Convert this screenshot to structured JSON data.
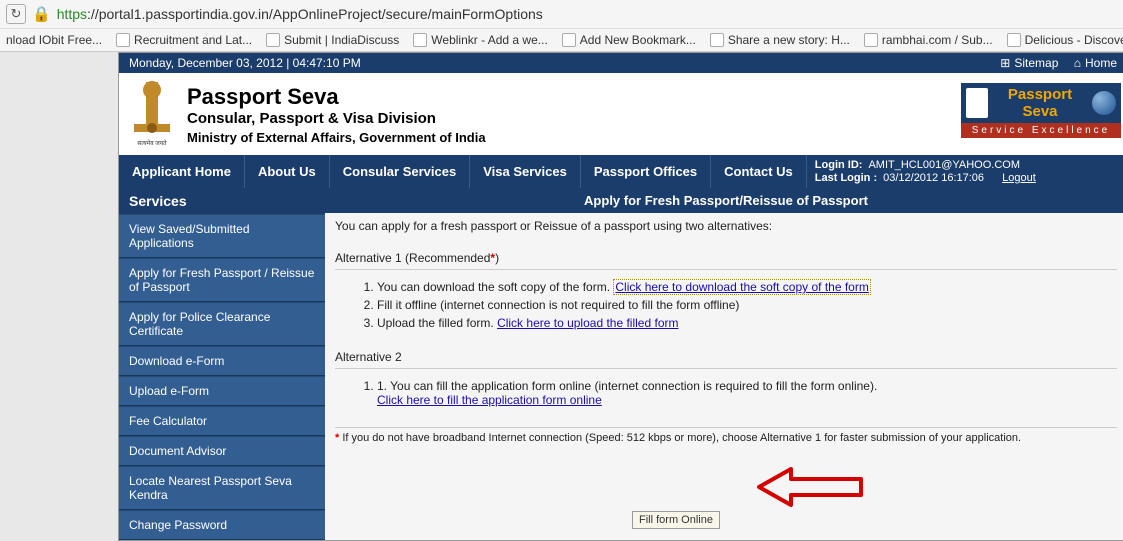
{
  "browser": {
    "url_https": "https",
    "url_rest": "://portal1.passportindia.gov.in/AppOnlineProject/secure/mainFormOptions",
    "bookmarks": [
      "nload IObit Free...",
      "Recruitment and Lat...",
      "Submit | IndiaDiscuss",
      "Weblinkr - Add a we...",
      "Add New Bookmark...",
      "Share a new story: H...",
      "rambhai.com / Sub...",
      "Delicious - Discover"
    ]
  },
  "topbar": {
    "datetime": "Monday,  December  03, 2012 | 04:47:10 PM",
    "sitemap": "Sitemap",
    "home": "Home"
  },
  "header": {
    "title1": "Passport Seva",
    "title2": "Consular, Passport & Visa Division",
    "title3": "Ministry of External Affairs, Government of India",
    "emblem_subtext": "सत्यमेव जयते",
    "rb_label1": "Passport",
    "rb_label2": "Seva",
    "rb_tagline": "Service Excellence"
  },
  "nav": {
    "items": [
      "Applicant Home",
      "About Us",
      "Consular Services",
      "Visa Services",
      "Passport Offices",
      "Contact Us"
    ],
    "login_id_label": "Login ID:",
    "login_id_value": "AMIT_HCL001@YAHOO.COM",
    "last_login_label": "Last Login :",
    "last_login_value": "03/12/2012 16:17:06",
    "logout": "Logout"
  },
  "sidebar": {
    "header": "Services",
    "items": [
      "View Saved/Submitted Applications",
      "Apply for Fresh Passport / Reissue of Passport",
      "Apply for Police Clearance Certificate",
      "Download e-Form",
      "Upload e-Form",
      "Fee Calculator",
      "Document Advisor",
      "Locate Nearest Passport Seva Kendra",
      "Change Password"
    ]
  },
  "main": {
    "header": "Apply for Fresh Passport/Reissue of Passport",
    "intro": "You can apply for a fresh passport or Reissue of a passport using two alternatives:",
    "alt1_title": "Alternative 1 (Recommended",
    "alt1_titletail": ")",
    "alt1_step1_pre": "You can download the soft copy of the form. ",
    "alt1_step1_link": "Click here to download the soft copy of the form",
    "alt1_step2": "Fill it offline (internet connection is not required to fill the form offline)",
    "alt1_step3_pre": "Upload the filled form. ",
    "alt1_step3_link": "Click here to upload the filled form",
    "alt2_title": "Alternative 2",
    "alt2_step1_pre": "1. You can fill the application form online (internet connection is required to fill the form online).",
    "alt2_step1_link": "Click here to fill the application form online",
    "footnote": " If you do not have broadband Internet connection (Speed: 512 kbps or more), choose Alternative 1 for faster submission of your application.",
    "tooltip": "Fill form Online"
  }
}
